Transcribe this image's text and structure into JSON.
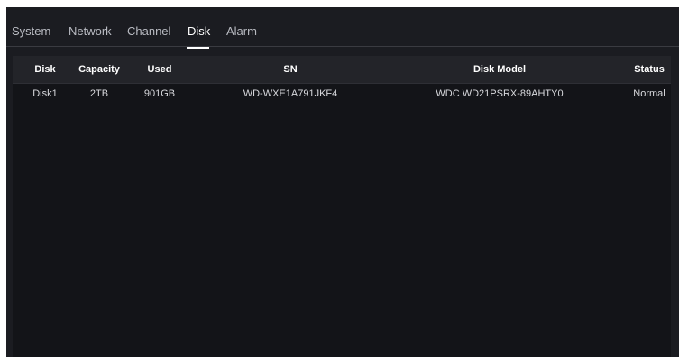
{
  "tabs": [
    "System",
    "Network",
    "Channel",
    "Disk",
    "Alarm"
  ],
  "active_tab": "Disk",
  "table": {
    "headers": [
      "Disk",
      "Capacity",
      "Used",
      "SN",
      "Disk Model",
      "Status"
    ],
    "rows": [
      [
        "Disk1",
        "2TB",
        "901GB",
        "WD-WXE1A791JKF4",
        "WDC WD21PSRX-89AHTY0",
        "Normal"
      ]
    ]
  },
  "colors": {
    "background": "#1b1c21",
    "table_body": "#131418",
    "header_row": "#232429",
    "active_tab": "#ffffff"
  }
}
